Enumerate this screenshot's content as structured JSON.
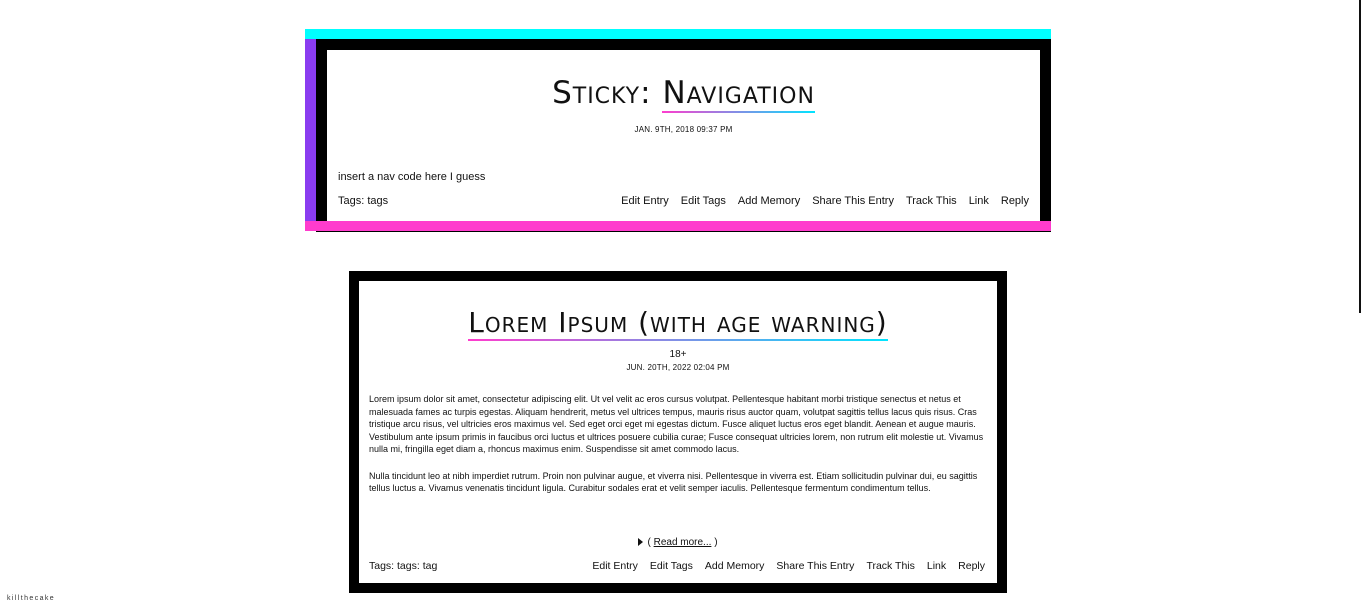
{
  "sticky": {
    "title_prefix": "Sticky:",
    "title_link": "Navigation",
    "date": "JAN. 9TH, 2018 09:37 PM",
    "body": "insert a nav code here I guess",
    "tags": "Tags: tags",
    "actions": [
      "Edit Entry",
      "Edit Tags",
      "Add Memory",
      "Share This Entry",
      "Track This",
      "Link",
      "Reply"
    ]
  },
  "entry": {
    "title": "Lorem Ipsum (with age warning)",
    "rating": "18+",
    "date": "JUN. 20TH, 2022 02:04 PM",
    "paragraphs": [
      "Lorem ipsum dolor sit amet, consectetur adipiscing elit. Ut vel velit ac eros cursus volutpat. Pellentesque habitant morbi tristique senectus et netus et malesuada fames ac turpis egestas. Aliquam hendrerit, metus vel ultrices tempus, mauris risus auctor quam, volutpat sagittis tellus lacus quis risus. Cras tristique arcu risus, vel ultricies eros maximus vel. Sed eget orci eget mi egestas dictum. Fusce aliquet luctus eros eget blandit. Aenean et augue mauris. Vestibulum ante ipsum primis in faucibus orci luctus et ultrices posuere cubilia curae; Fusce consequat ultricies lorem, non rutrum elit molestie ut. Vivamus nulla mi, fringilla eget diam a, rhoncus maximus enim. Suspendisse sit amet commodo lacus.",
      "Nulla tincidunt leo at nibh imperdiet rutrum. Proin non pulvinar augue, et viverra nisi. Pellentesque in viverra est. Etiam sollicitudin pulvinar dui, eu sagittis tellus luctus a. Vivamus venenatis tincidunt ligula. Curabitur sodales erat et velit semper iaculis. Pellentesque fermentum condimentum tellus."
    ],
    "read_more_open": "(",
    "read_more_link": "Read more...",
    "read_more_close": ")",
    "tags": "Tags: tags: tag",
    "actions": [
      "Edit Entry",
      "Edit Tags",
      "Add Memory",
      "Share This Entry",
      "Track This",
      "Link",
      "Reply"
    ]
  },
  "credit": "killthecake",
  "colors": {
    "cyan": "#00ffff",
    "purple": "#8a3cf0",
    "pink": "#ff3ccd",
    "border": "#000000"
  }
}
